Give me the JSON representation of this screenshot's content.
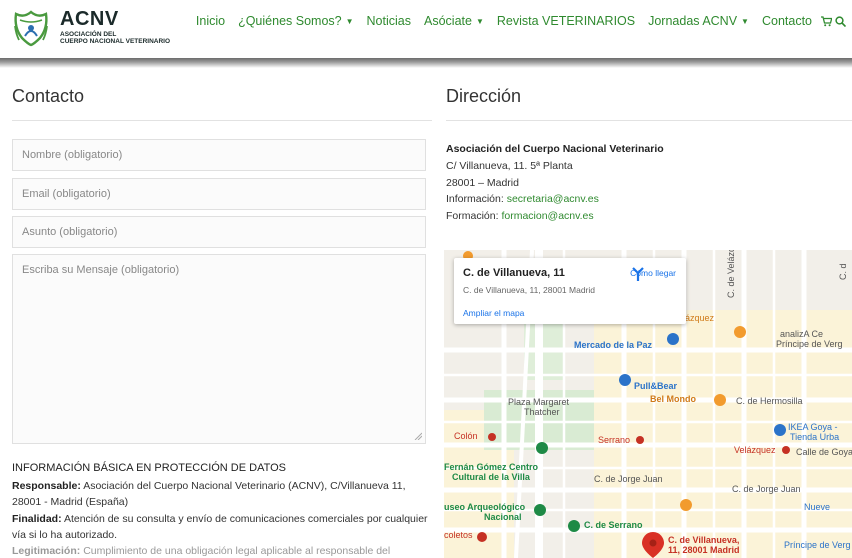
{
  "header": {
    "logo_title": "ACNV",
    "logo_sub_1": "ASOCIACIÓN DEL",
    "logo_sub_2": "CUERPO NACIONAL VETERINARIO",
    "nav": [
      {
        "label": "Inicio",
        "caret": false
      },
      {
        "label": "¿Quiénes Somos?",
        "caret": true
      },
      {
        "label": "Noticias",
        "caret": false
      },
      {
        "label": "Asóciate",
        "caret": true
      },
      {
        "label": "Revista VETERINARIOS",
        "caret": false
      },
      {
        "label": "Jornadas ACNV",
        "caret": true
      },
      {
        "label": "Contacto",
        "caret": false
      }
    ],
    "icons": [
      "cart-icon",
      "search-icon"
    ],
    "accent": "#2f8a2f"
  },
  "contact": {
    "title": "Contacto",
    "name_placeholder": "Nombre (obligatorio)",
    "email_placeholder": "Email (obligatorio)",
    "subject_placeholder": "Asunto (obligatorio)",
    "message_placeholder": "Escriba su Mensaje (obligatorio)",
    "info_title": "INFORMACIÓN BÁSICA EN PROTECCIÓN DE DATOS",
    "responsable_label": "Responsable:",
    "responsable_text": "Asociación del Cuerpo Nacional Veterinario (ACNV), C/Villanueva 11, 28001 - Madrid (España)",
    "finalidad_label": "Finalidad:",
    "finalidad_text": "Atención de su consulta y envío de comunicaciones comerciales por cualquier vía si lo ha autorizado.",
    "legitimacion_label": "Legitimación:",
    "legitimacion_text": "Cumplimiento de una obligación legal aplicable al responsable del"
  },
  "address": {
    "title": "Dirección",
    "org": "Asociación del Cuerpo Nacional Veterinario",
    "street": "C/ Villanueva, 11. 5ª Planta",
    "city": "28001 – Madrid",
    "info_label": "Información:",
    "info_email": "secretaria@acnv.es",
    "training_label": "Formación:",
    "training_email": "formacion@acnv.es"
  },
  "map": {
    "card_title": "C. de Villanueva, 11",
    "card_address": "C. de Villanueva, 11, 28001 Madrid",
    "directions_label": "Cómo llegar",
    "expand_link": "Ampliar el mapa",
    "labels": {
      "mercado": "Mercado de la Paz",
      "pullbear": "Pull&Bear",
      "belmondo": "Bel Mondo",
      "hermosilla": "C. de Hermosilla",
      "plaza1": "Plaza Margaret",
      "plaza2": "Thatcher",
      "colon": "Colón",
      "serrano_metro": "Serrano",
      "velazquez_metro": "Velázquez",
      "calle_goya": "Calle de Goya",
      "fernan1": "Fernán Gómez Centro",
      "fernan2": "Cultural de la Villa",
      "jorge_juan_1": "C. de Jorge Juan",
      "jorge_juan_2": "C. de Jorge Juan",
      "museo1": "useo Arqueológico",
      "museo2": "Nacional",
      "c_serrano": "C. de Serrano",
      "coletos": "coletos",
      "pin1": "C. de Villanueva,",
      "pin2": "11, 28001 Madrid",
      "principe_bottom": "Príncipe de Verg",
      "nuevo": "Nueve",
      "ikea1": "IKEA Goya -",
      "ikea2": "Tienda Urba",
      "analiza1": "analizA Ce",
      "analiza2": "Príncipe de Verg",
      "velazquez_top": "uca - Velázquez",
      "c_velaz": "C. de Velázq",
      "ca": "C. d"
    }
  }
}
